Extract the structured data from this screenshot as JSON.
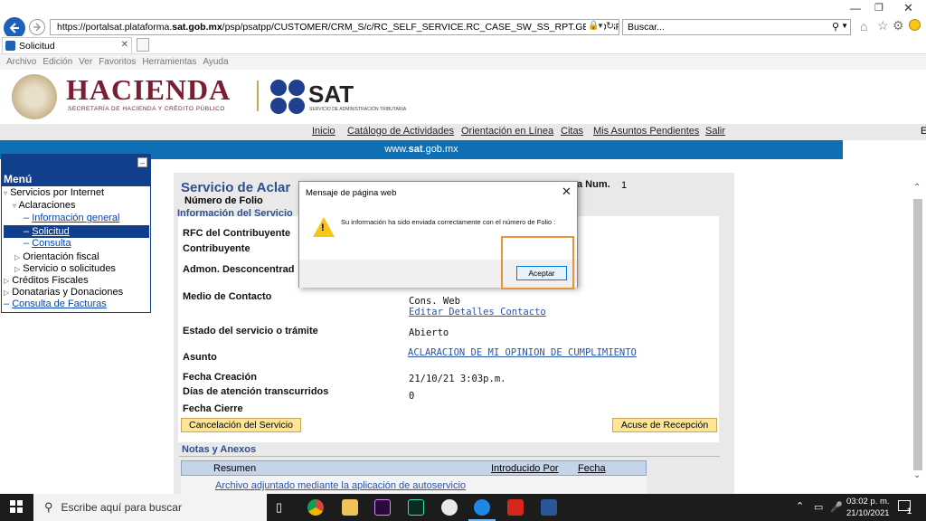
{
  "browser": {
    "url_prefix": "https://portalsat.plataforma.",
    "url_domain": "sat.gob.mx",
    "url_rest": "/psp/psatpp/CUSTOMER/CRM_S/c/RC_SELF_SERVICE.RC_CASE_SW_SS_RPT.GBL?DISP_TMPL_ID=RC_SUPI",
    "search_placeholder": "Buscar...",
    "tab_title": "Solicitud",
    "menu": [
      "Archivo",
      "Edición",
      "Ver",
      "Favoritos",
      "Herramientas",
      "Ayuda"
    ]
  },
  "header": {
    "hacienda_title": "HACIENDA",
    "hacienda_subtitle": "SECRETARÍA DE HACIENDA Y CRÉDITO PÚBLICO",
    "sat_title": "SAT",
    "sat_subtitle": "SERVICIO DE ADMINISTRACIÓN TRIBUTARIA"
  },
  "topnav": {
    "items": [
      "Inicio",
      "Catálogo de Actividades",
      "Orientación en Línea",
      "Citas",
      "Mis Asuntos Pendientes",
      "Salir"
    ],
    "right_fragment": "E"
  },
  "bluebar": {
    "text_pre": "www.",
    "text_bold": "sat",
    "text_post": ".gob.mx"
  },
  "sidebar": {
    "title": "Menú",
    "items": [
      {
        "label": "Servicios por Internet"
      },
      {
        "label": "Aclaraciones"
      },
      {
        "label": "Información general"
      },
      {
        "label": "Solicitud"
      },
      {
        "label": "Consulta"
      },
      {
        "label": "Orientación fiscal"
      },
      {
        "label": "Servicio o solicitudes"
      },
      {
        "label": "Créditos Fiscales"
      },
      {
        "label": "Donatarias y Donaciones"
      },
      {
        "label": "Consulta de Facturas"
      }
    ]
  },
  "content": {
    "title_fragment": "Servicio de Aclar",
    "ticket_fragment": "a Num.",
    "ticket_number": "1",
    "folio_label": "Número de Folio",
    "section_fragment": "Información del Servicio",
    "rfc_label": "RFC del Contribuyente",
    "contrib_label": "Contribuyente",
    "admon_label": "Admon. Desconcentrad",
    "medio_label": "Medio de Contacto",
    "medio_value": "Cons. Web",
    "edit_contact_link": "Editar Detalles Contacto",
    "estado_label": "Estado del servicio o trámite",
    "estado_value": "Abierto",
    "asunto_label": "Asunto",
    "asunto_value": "ACLARACION DE MI OPINION DE CUMPLIMIENTO",
    "fecha_creacion_label": "Fecha Creación",
    "fecha_creacion_value": "21/10/21  3:03p.m.",
    "dias_label": "Días de atención transcurridos",
    "dias_value": "0",
    "fecha_cierre_label": "Fecha Cierre",
    "cancel_button": "Cancelación del Servicio",
    "acuse_button": "Acuse de Recepción",
    "notas_title": "Notas y Anexos",
    "table_headers": [
      "Resumen",
      "Introducido Por",
      "Fecha"
    ],
    "table_row": [
      "Archivo adjuntado mediante la aplicación de autoservicio"
    ]
  },
  "dialog": {
    "title": "Mensaje de página web",
    "message": "Su información ha sido enviada correctamente con el número de Folio :",
    "accept_button": "Aceptar"
  },
  "taskbar": {
    "search_placeholder": "Escribe aquí para buscar",
    "time": "03:02 p. m.",
    "date": "21/10/2021",
    "notif_count": "1"
  },
  "colors": {
    "accent_blue": "#0e6fb5",
    "menu_dark": "#123f8b",
    "hacienda_red": "#7a1f32",
    "highlight_orange": "#e8923a"
  }
}
